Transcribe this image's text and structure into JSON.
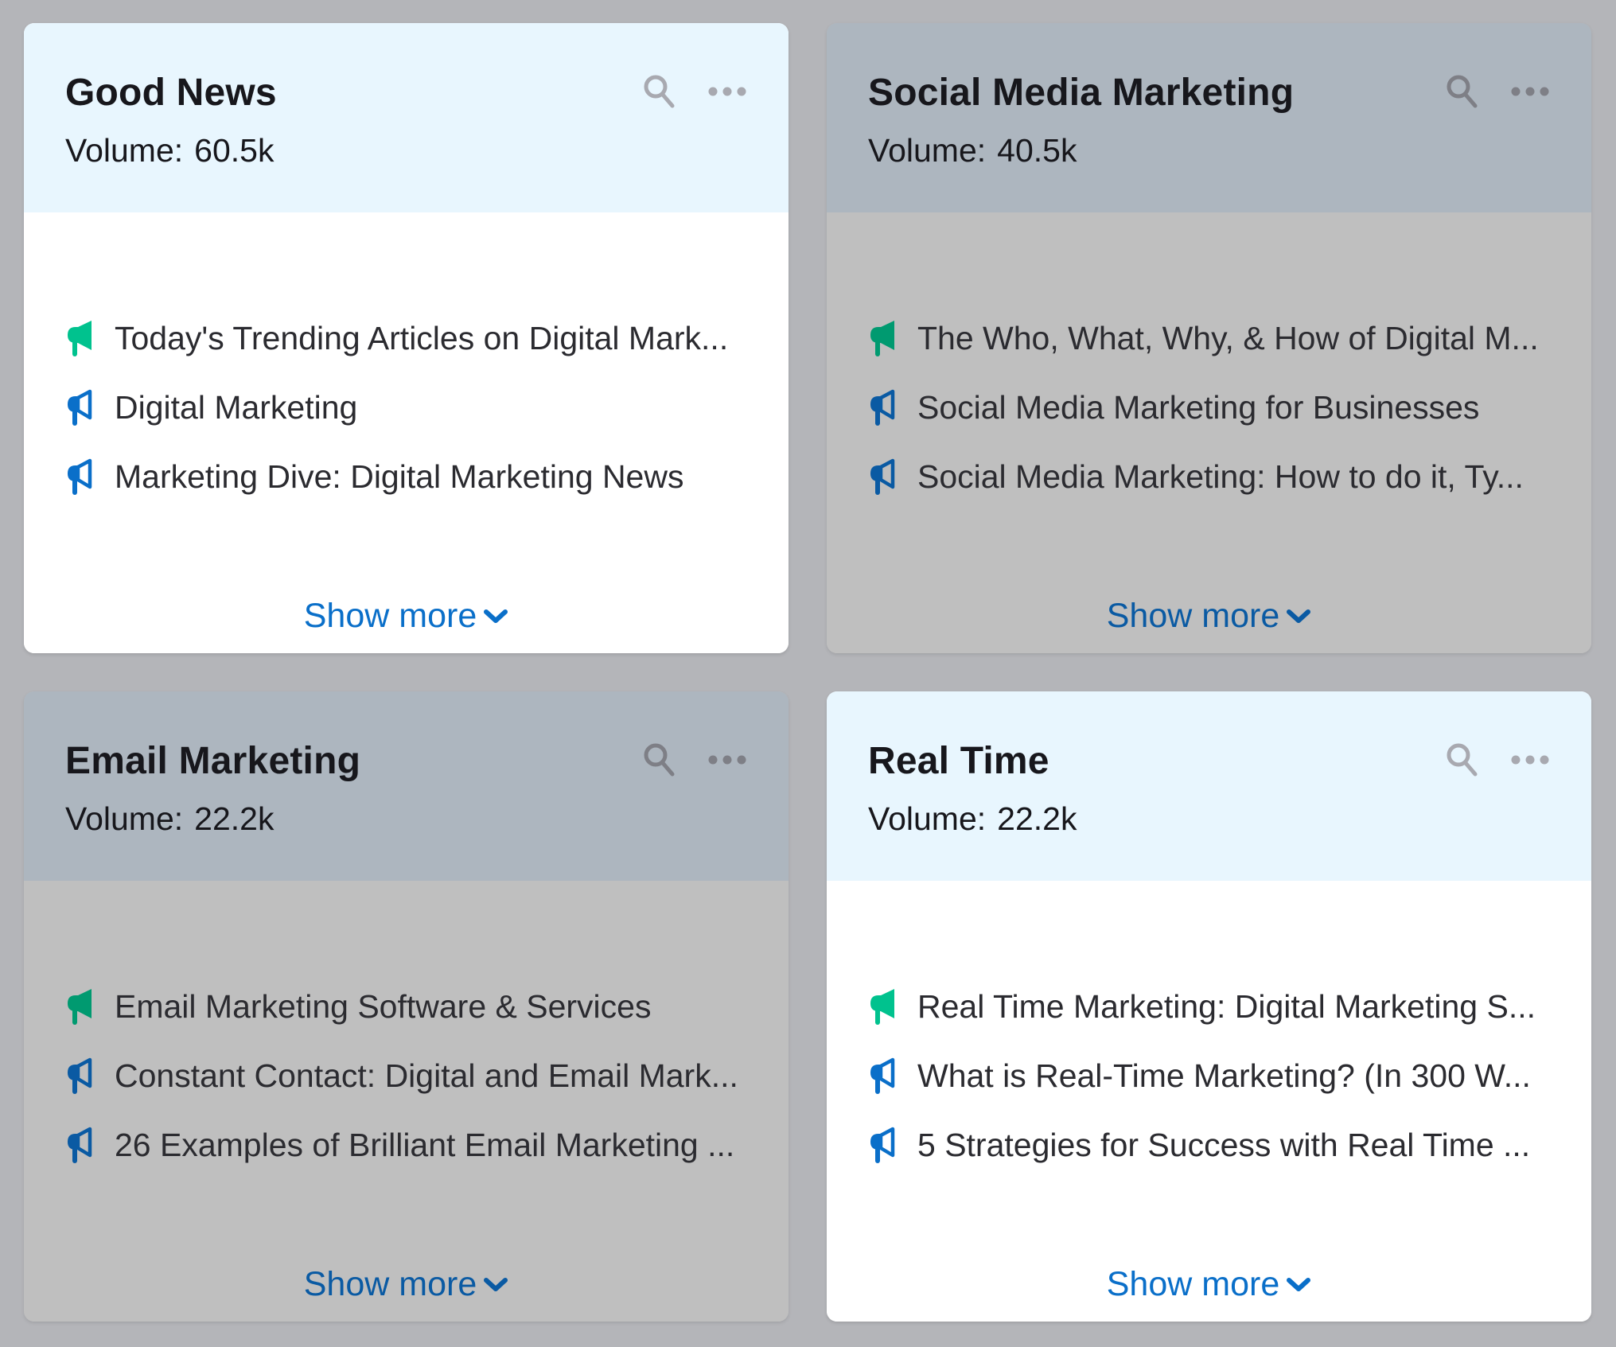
{
  "colors": {
    "accent_green": "#00c28e",
    "accent_blue": "#0a6fc9",
    "icon_gray": "#a8a9b0",
    "active_header": "#e8f6fe",
    "dim_header": "#adb6bf",
    "dim_body": "#bfbfbf",
    "page_bg": "#b4b5b9"
  },
  "cards": [
    {
      "title": "Good News",
      "volume_label": "Volume:",
      "volume_value": "60.5k",
      "state": "active",
      "icons": {
        "search": "search-icon",
        "more": "more-options-icon"
      },
      "items": [
        {
          "text": "Today's Trending Articles on Digital Mark...",
          "icon": "megaphone-filled-icon",
          "color": "green"
        },
        {
          "text": "Digital Marketing",
          "icon": "megaphone-outline-icon",
          "color": "blue"
        },
        {
          "text": "Marketing Dive: Digital Marketing News",
          "icon": "megaphone-outline-icon",
          "color": "blue"
        }
      ],
      "show_more": "Show more"
    },
    {
      "title": "Social Media Marketing",
      "volume_label": "Volume:",
      "volume_value": "40.5k",
      "state": "dimmed",
      "icons": {
        "search": "search-icon",
        "more": "more-options-icon"
      },
      "items": [
        {
          "text": "The Who, What, Why, & How of Digital M...",
          "icon": "megaphone-filled-icon",
          "color": "green"
        },
        {
          "text": "Social Media Marketing for Businesses",
          "icon": "megaphone-outline-icon",
          "color": "blue"
        },
        {
          "text": "Social Media Marketing: How to do it, Ty...",
          "icon": "megaphone-outline-icon",
          "color": "blue"
        }
      ],
      "show_more": "Show more"
    },
    {
      "title": "Email Marketing",
      "volume_label": "Volume:",
      "volume_value": "22.2k",
      "state": "dimmed",
      "icons": {
        "search": "search-icon",
        "more": "more-options-icon"
      },
      "items": [
        {
          "text": "Email Marketing Software & Services",
          "icon": "megaphone-filled-icon",
          "color": "green"
        },
        {
          "text": "Constant Contact: Digital and Email Mark...",
          "icon": "megaphone-outline-icon",
          "color": "blue"
        },
        {
          "text": "26 Examples of Brilliant Email Marketing ...",
          "icon": "megaphone-outline-icon",
          "color": "blue"
        }
      ],
      "show_more": "Show more"
    },
    {
      "title": "Real Time",
      "volume_label": "Volume:",
      "volume_value": "22.2k",
      "state": "active",
      "icons": {
        "search": "search-icon",
        "more": "more-options-icon"
      },
      "items": [
        {
          "text": "Real Time Marketing: Digital Marketing S...",
          "icon": "megaphone-filled-icon",
          "color": "green"
        },
        {
          "text": "What is Real-Time Marketing? (In 300 W...",
          "icon": "megaphone-outline-icon",
          "color": "blue"
        },
        {
          "text": "5 Strategies for Success with Real Time ...",
          "icon": "megaphone-outline-icon",
          "color": "blue"
        }
      ],
      "show_more": "Show more"
    }
  ]
}
